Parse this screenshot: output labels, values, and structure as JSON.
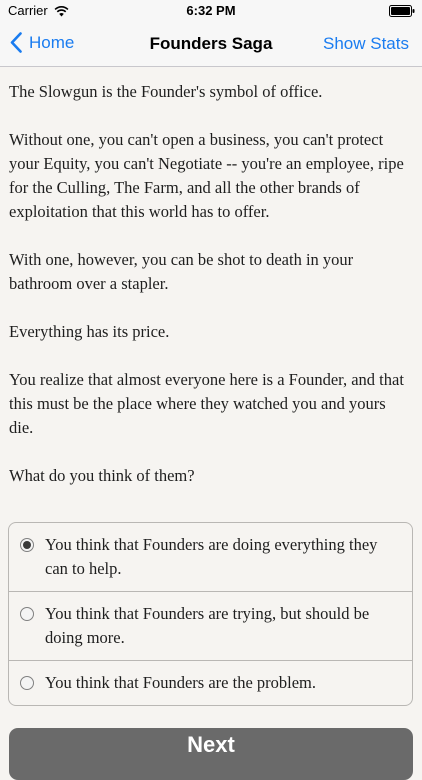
{
  "status_bar": {
    "carrier": "Carrier",
    "time": "6:32 PM"
  },
  "nav": {
    "back_label": "Home",
    "title": "Founders Saga",
    "right_label": "Show Stats",
    "accent_color": "#1a7cf0"
  },
  "body": {
    "paragraphs": [
      "The Slowgun is the Founder's symbol of office.",
      "Without one, you can't open a business, you can't protect your Equity, you can't Negotiate -- you're an employee, ripe for the Culling, The Farm, and all the other brands of exploitation that this world has to offer.",
      "With one, however, you can be shot to death in your bathroom over a stapler.",
      "Everything has its price.",
      "You realize that almost everyone here is a Founder, and that this must be the place where they watched you and yours die.",
      "What do you think of them?"
    ]
  },
  "choices": [
    {
      "label": "You think that Founders are doing everything they can to help.",
      "selected": true
    },
    {
      "label": "You think that Founders are trying, but should be doing more.",
      "selected": false
    },
    {
      "label": "You think that Founders are the problem.",
      "selected": false
    }
  ],
  "next_button": {
    "label": "Next"
  }
}
